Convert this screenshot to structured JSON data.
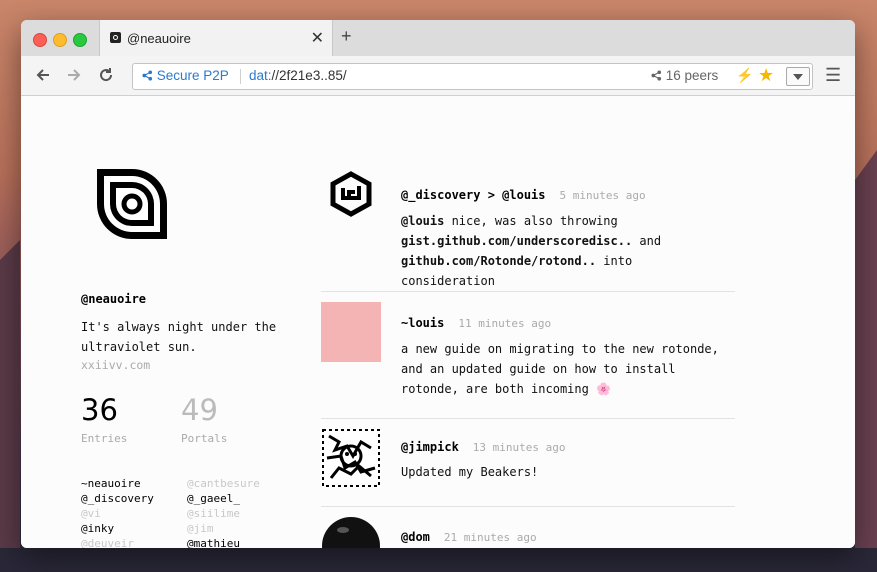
{
  "browser": {
    "tab_title": "@neauoire",
    "tab_close": "✕",
    "new_tab": "+",
    "secure_label": "Secure P2P",
    "url_scheme": "dat:",
    "url_rest": "//2f21e3..85/",
    "peers": "16 peers"
  },
  "profile": {
    "name": "@neauoire",
    "bio": "It's always night under the ultraviolet sun.",
    "site": "xxiivv.com",
    "entries_count": "36",
    "entries_label": "Entries",
    "portals_count": "49",
    "portals_label": "Portals",
    "portals_left": [
      {
        "name": "~neauoire",
        "dim": false
      },
      {
        "name": "@_discovery",
        "dim": false
      },
      {
        "name": "@vi",
        "dim": true
      },
      {
        "name": "@inky",
        "dim": false
      },
      {
        "name": "@deuveir",
        "dim": true
      }
    ],
    "portals_right": [
      {
        "name": "@cantbesure",
        "dim": true
      },
      {
        "name": "@_gaeel_",
        "dim": false
      },
      {
        "name": "@siilime",
        "dim": true
      },
      {
        "name": "@jim",
        "dim": true
      },
      {
        "name": "@mathieu",
        "dim": false
      }
    ]
  },
  "feed": [
    {
      "author": "@_discovery > @louis",
      "time": "5 minutes ago",
      "mention": "@louis",
      "text_a": " nice, was also throwing ",
      "link1": "gist.github.com/underscoredisc..",
      "text_b": " and ",
      "link2": "github.com/Rotonde/rotond..",
      "text_c": " into consideration"
    },
    {
      "author": "~louis",
      "time": "11 minutes ago",
      "text": "a new guide on migrating to the new rotonde, and an updated guide on how to install rotonde, are both incoming 🌸",
      "avatar_color": "#f4b4b4"
    },
    {
      "author": "@jimpick",
      "time": "13 minutes ago",
      "text": "Updated my Beakers!"
    },
    {
      "author": "@dom",
      "time": "21 minutes ago"
    }
  ]
}
